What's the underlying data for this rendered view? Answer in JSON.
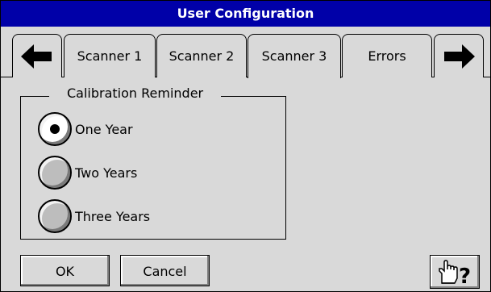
{
  "window": {
    "title": "User Configuration"
  },
  "tabs": [
    {
      "label": "Scanner 1",
      "active": false
    },
    {
      "label": "Scanner 2",
      "active": false
    },
    {
      "label": "Scanner 3",
      "active": true
    },
    {
      "label": "Errors",
      "active": false
    }
  ],
  "nav": {
    "left_icon": "arrow-left-icon",
    "right_icon": "arrow-right-icon"
  },
  "calibration": {
    "group_label": "Calibration Reminder",
    "options": [
      {
        "label": "One Year",
        "selected": true
      },
      {
        "label": "Two Years",
        "selected": false
      },
      {
        "label": "Three Years",
        "selected": false
      }
    ]
  },
  "buttons": {
    "ok_label": "OK",
    "cancel_label": "Cancel",
    "help_icon": "help-pointer-icon"
  },
  "colors": {
    "title_bar": "#0000a8",
    "background": "#d9d9d9"
  }
}
